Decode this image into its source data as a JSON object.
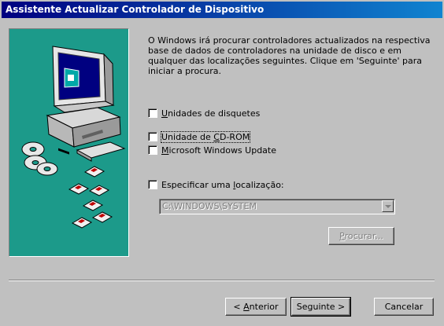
{
  "window": {
    "title": "Assistente Actualizar Controlador de Dispositivo"
  },
  "description": "O Windows irá procurar controladores actualizados na respectiva base de dados de controladores na unidade de disco e em qualquer das localizações seguintes. Clique em 'Seguinte' para iniciar a procura.",
  "options": {
    "floppy": {
      "pre": "",
      "key": "U",
      "post": "nidades de disquetes",
      "checked": false
    },
    "cdrom": {
      "pre": "Unidade de ",
      "key": "C",
      "post": "D-ROM",
      "checked": false
    },
    "windows_update": {
      "pre": "",
      "key": "M",
      "post": "icrosoft Windows Update",
      "checked": false
    },
    "specify_location": {
      "pre": "Especificar uma ",
      "key": "l",
      "post": "ocalização:",
      "checked": false
    }
  },
  "location": {
    "value": "C:\\WINDOWS\\SYSTEM"
  },
  "buttons": {
    "browse": {
      "pre": "",
      "key": "P",
      "post": "rocurar..."
    },
    "back": {
      "pre": "< ",
      "key": "A",
      "post": "nterior"
    },
    "next": "Seguinte >",
    "cancel": "Cancelar"
  },
  "colors": {
    "titlebar_start": "#000080",
    "titlebar_end": "#1084d0",
    "face": "#c0c0c0",
    "illustration_bg": "#1c9a8a"
  },
  "icons": [
    "computer-icon",
    "cd-icon",
    "floppy-disk-icon",
    "dropdown-arrow-icon"
  ]
}
